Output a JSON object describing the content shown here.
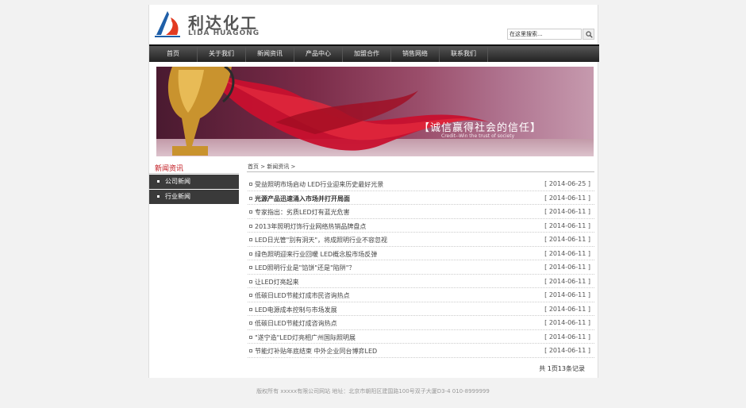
{
  "header": {
    "brand_cn": "利达化工",
    "brand_en": "LIDA HUAGONG",
    "search_value": "在这里搜索..."
  },
  "nav": [
    "首页",
    "关于我们",
    "新闻资讯",
    "产品中心",
    "加盟合作",
    "销售网络",
    "联系我们"
  ],
  "banner": {
    "slogan": "【诚信赢得社会的信任】",
    "slogan_en": "Credit--Win the trust of society"
  },
  "sidebar": {
    "title": "新闻资讯",
    "items": [
      "公司新闻",
      "行业新闻"
    ]
  },
  "breadcrumb": "首页 > 新闻资讯 >",
  "news": [
    {
      "title": "受益照明市场启动 LED行业迎来历史最好光景",
      "date": "[ 2014-06-25 ]",
      "bold": false
    },
    {
      "title": "光源产品迅速涌入市场并打开局面",
      "date": "[ 2014-06-11 ]",
      "bold": true
    },
    {
      "title": "专家指出：劣质LED灯有蓝光危害",
      "date": "[ 2014-06-11 ]",
      "bold": false
    },
    {
      "title": "2013年照明灯饰行业网络热销品牌盘点",
      "date": "[ 2014-06-11 ]",
      "bold": false
    },
    {
      "title": "LED日光管\"别有洞天\"，将成照明行业不容忽视",
      "date": "[ 2014-06-11 ]",
      "bold": false
    },
    {
      "title": "绿色照明迎来行业回暖 LED概念股市场反弹",
      "date": "[ 2014-06-11 ]",
      "bold": false
    },
    {
      "title": "LED照明行业是\"馅饼\"还是\"陷阱\"？",
      "date": "[ 2014-06-11 ]",
      "bold": false
    },
    {
      "title": "让LED灯亮起来",
      "date": "[ 2014-06-11 ]",
      "bold": false
    },
    {
      "title": "低碳日LED节能灯成市民咨询热点",
      "date": "[ 2014-06-11 ]",
      "bold": false
    },
    {
      "title": "LED电源成本控制与市场发展",
      "date": "[ 2014-06-11 ]",
      "bold": false
    },
    {
      "title": "低碳日LED节能灯成咨询热点",
      "date": "[ 2014-06-11 ]",
      "bold": false
    },
    {
      "title": "\"遂宁造\"LED灯亮相广州国际照明展",
      "date": "[ 2014-06-11 ]",
      "bold": false
    },
    {
      "title": "节能灯补贴年底结束 中外企业同台博弈LED",
      "date": "[ 2014-06-11 ]",
      "bold": false
    }
  ],
  "pager": "共 1页13条记录",
  "footer": "版权所有 xxxxx有限公司网站 地址：北京市朝阳区建国路100号双子大厦D3-4 010-8999999"
}
